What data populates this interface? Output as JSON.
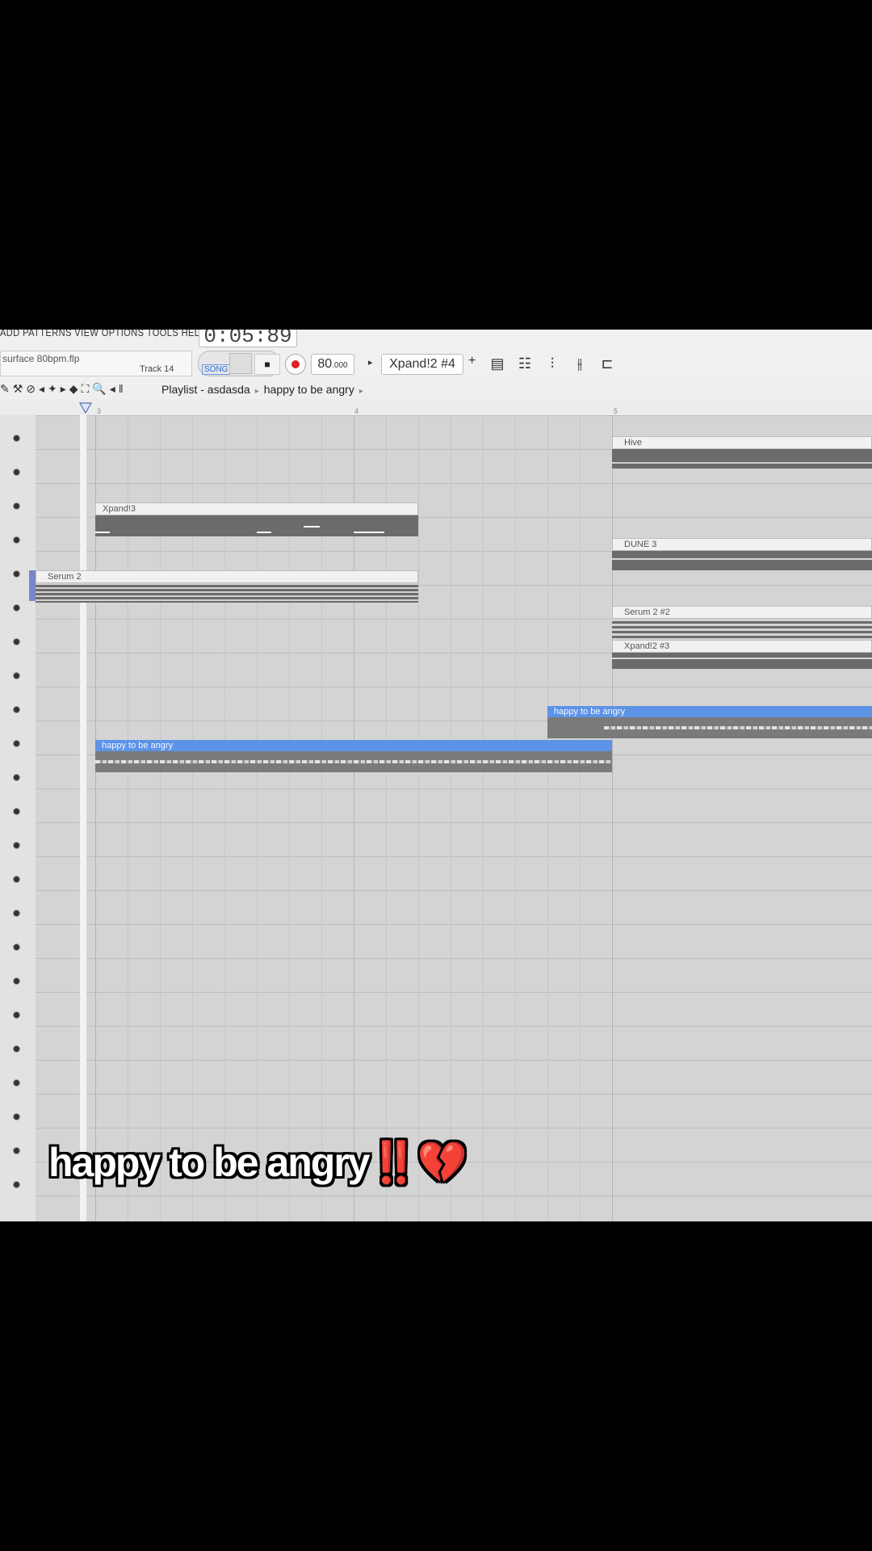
{
  "menubar": {
    "text": "ADD PATTERNS VIEW OPTIONS TOOLS HELP"
  },
  "transport": {
    "time": "0:05:89",
    "file_name": "surface 80bpm.flp",
    "track_hint": "Track 14",
    "song_mode": "SONG",
    "stop_symbol": "■",
    "tempo_main": "80",
    "tempo_frac": ".000",
    "pattern": "Xpand!2 #4",
    "plus": "+"
  },
  "breadcrumb": {
    "root": "Playlist - asdasda",
    "current": "happy to be angry"
  },
  "ruler": {
    "ticks": [
      "3",
      "4",
      "5"
    ]
  },
  "clips": {
    "xpand3": "Xpand!3",
    "serum2": "Serum 2",
    "hive": "Hive",
    "dune3": "DUNE 3",
    "serum2_2": "Serum 2 #2",
    "xpand2_3": "Xpand!2 #3",
    "audio1": "happy to be angry",
    "audio2": "happy to be angry"
  },
  "caption": {
    "text": "happy to be angry",
    "emoji": "‼️💔"
  },
  "colors": {
    "audio_clip": "#5d93e6",
    "record": "#dd2222",
    "song_label": "#2a6bd8"
  }
}
